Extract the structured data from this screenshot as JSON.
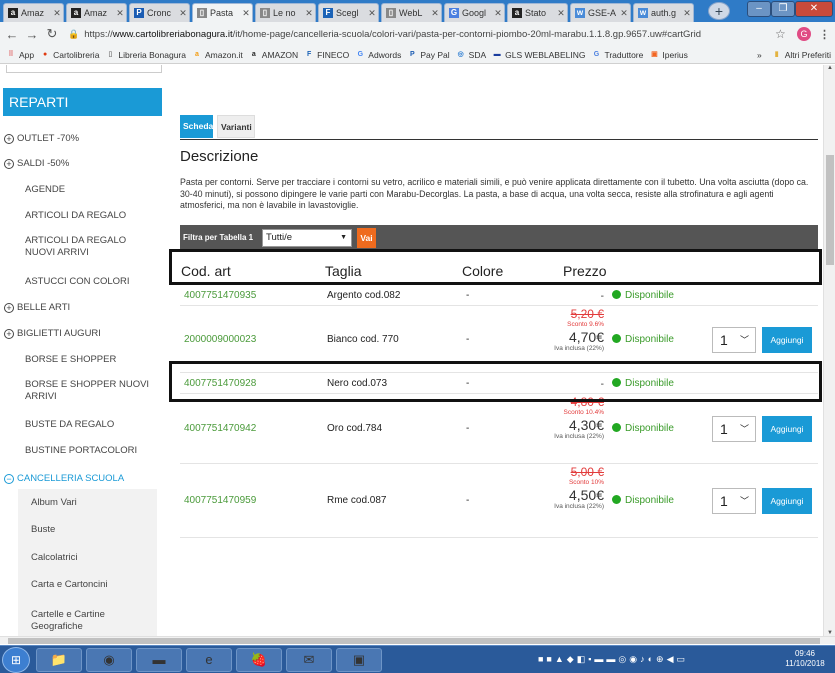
{
  "browser": {
    "tabs": [
      {
        "title": "Amaz",
        "icon": "amazon-icon",
        "color": "#222222",
        "glyph": "a"
      },
      {
        "title": "Amaz",
        "icon": "amazon-icon",
        "color": "#222222",
        "glyph": "a"
      },
      {
        "title": "Cronc",
        "icon": "paypal-icon",
        "color": "#1b5cb3",
        "glyph": "P"
      },
      {
        "title": "Pasta",
        "icon": "page-icon",
        "color": "#888888",
        "glyph": "▯"
      },
      {
        "title": "Le no",
        "icon": "page-icon",
        "color": "#888888",
        "glyph": "▯"
      },
      {
        "title": "Scegl",
        "icon": "fineco-icon",
        "color": "#1c63b7",
        "glyph": "F"
      },
      {
        "title": "WebL",
        "icon": "page-icon",
        "color": "#888888",
        "glyph": "▯"
      },
      {
        "title": "Googl",
        "icon": "google-translate-icon",
        "color": "#4a7fe0",
        "glyph": "G"
      },
      {
        "title": "Stato",
        "icon": "amazon-icon",
        "color": "#222222",
        "glyph": "a"
      },
      {
        "title": "GSE-A",
        "icon": "gse-icon",
        "color": "#4a8bd8",
        "glyph": "w"
      },
      {
        "title": "auth.g",
        "icon": "gse-icon",
        "color": "#4a8bd8",
        "glyph": "w"
      }
    ],
    "active_tab_index": 3,
    "new_tab_symbol": "+",
    "window_buttons": {
      "minimize": "–",
      "maximize": "❐",
      "close": "✕"
    },
    "url_prefix": "https://",
    "url_domain": "www.cartolibreriabonagura.it",
    "url_path": "/it/home-page/cancelleria-scuola/colori-vari/pasta-per-contorni-piombo-20ml-marabu.1.1.8.gp.9657.uw#cartGrid",
    "profile_initial": "G",
    "bookmarks": [
      {
        "label": "App",
        "icon": "apps-icon",
        "color": "#e06666",
        "glyph": "⠿"
      },
      {
        "label": "Cartolibreria",
        "icon": "cartolibreria-icon",
        "color": "#e03a10",
        "glyph": "●"
      },
      {
        "label": "Libreria Bonagura",
        "icon": "page-icon",
        "color": "#888888",
        "glyph": "▯"
      },
      {
        "label": "Amazon.it",
        "icon": "amazon-icon",
        "color": "#f39c12",
        "glyph": "a"
      },
      {
        "label": "AMAZON",
        "icon": "amazon-icon",
        "color": "#222222",
        "glyph": "a"
      },
      {
        "label": "FINECO",
        "icon": "fineco-icon",
        "color": "#1c63b7",
        "glyph": "F"
      },
      {
        "label": "Adwords",
        "icon": "google-icon",
        "color": "#4285f4",
        "glyph": "G"
      },
      {
        "label": "Pay Pal",
        "icon": "paypal-icon",
        "color": "#1b5cb3",
        "glyph": "P"
      },
      {
        "label": "SDA",
        "icon": "sda-icon",
        "color": "#2d7dd2",
        "glyph": "◎"
      },
      {
        "label": "GLS WEBLABELING",
        "icon": "gls-icon",
        "color": "#1a3c9e",
        "glyph": "▬"
      },
      {
        "label": "Traduttore",
        "icon": "translate-icon",
        "color": "#4a7fe0",
        "glyph": "G"
      },
      {
        "label": "Iperius",
        "icon": "iperius-icon",
        "color": "#f26522",
        "glyph": "▣"
      }
    ],
    "bookmarks_more": "»",
    "other_bookmarks": "Altri Preferiti"
  },
  "sidebar": {
    "heading": "REPARTI",
    "items": [
      {
        "label": "OUTLET -70%",
        "expandable": true
      },
      {
        "label": "SALDI -50%",
        "expandable": true
      },
      {
        "label": "AGENDE",
        "expandable": false
      },
      {
        "label": "ARTICOLI DA REGALO",
        "expandable": false
      },
      {
        "label": "ARTICOLI DA REGALO NUOVI ARRIVI",
        "expandable": false
      },
      {
        "label": "ASTUCCI CON COLORI",
        "expandable": false
      },
      {
        "label": "BELLE ARTI",
        "expandable": true
      },
      {
        "label": "BIGLIETTI AUGURI",
        "expandable": true
      },
      {
        "label": "BORSE E SHOPPER",
        "expandable": false
      },
      {
        "label": "BORSE E SHOPPER NUOVI ARRIVI",
        "expandable": false
      },
      {
        "label": "BUSTE DA REGALO",
        "expandable": false
      },
      {
        "label": "BUSTINE PORTACOLORI",
        "expandable": false
      },
      {
        "label": "CANCELLERIA SCUOLA",
        "expandable": true,
        "active": true
      }
    ],
    "sub_items": [
      {
        "label": "Album Vari"
      },
      {
        "label": "Buste"
      },
      {
        "label": "Calcolatrici"
      },
      {
        "label": "Carta e Cartoncini"
      },
      {
        "label": "Cartelle e Cartine Geografiche"
      }
    ]
  },
  "product": {
    "tabs": [
      {
        "label": "Scheda"
      },
      {
        "label": "Varianti"
      }
    ],
    "description_title": "Descrizione",
    "description_text": "Pasta per contorni. Serve per tracciare i contorni su vetro, acrilico e materiali simili, e può venire applicata direttamente con il tubetto. Una volta asciutta (dopo ca. 30-40 minuti), si possono dipingere le varie parti con Marabu-Decorglas. La pasta, a base di acqua, una volta secca, resiste alla strofinatura e agli agenti atmosferici, ma non è lavabile in lavastoviglie.",
    "filter": {
      "label": "Filtra per Tabella 1",
      "selected": "Tutti/e",
      "button": "Vai"
    },
    "columns": {
      "code": "Cod. art",
      "size": "Taglia",
      "color": "Colore",
      "price": "Prezzo"
    },
    "rows": [
      {
        "code": "4007751470935",
        "size": "Argento cod.082",
        "color": "-",
        "old_price": "",
        "discount": "",
        "price": "-",
        "vat": "",
        "availability": "Disponibile",
        "qty": "",
        "add": ""
      },
      {
        "code": "2000009000023",
        "size": "Bianco cod. 770",
        "color": "-",
        "old_price": "5,20 €",
        "discount": "Sconto 9.6%",
        "price": "4,70€",
        "vat": "Iva inclusa (22%)",
        "availability": "Disponibile",
        "qty": "1",
        "add": "Aggiungi"
      },
      {
        "code": "4007751470928",
        "size": "Nero cod.073",
        "color": "-",
        "old_price": "",
        "discount": "",
        "price": "-",
        "vat": "",
        "availability": "Disponibile",
        "qty": "",
        "add": ""
      },
      {
        "code": "4007751470942",
        "size": "Oro cod.784",
        "color": "-",
        "old_price": "4,80 €",
        "discount": "Sconto 10.4%",
        "price": "4,30€",
        "vat": "Iva inclusa (22%)",
        "availability": "Disponibile",
        "qty": "1",
        "add": "Aggiungi"
      },
      {
        "code": "4007751470959",
        "size": "Rme cod.087",
        "color": "-",
        "old_price": "5,00 €",
        "discount": "Sconto 10%",
        "price": "4,50€",
        "vat": "Iva inclusa (22%)",
        "availability": "Disponibile",
        "qty": "1",
        "add": "Aggiungi"
      }
    ]
  },
  "taskbar": {
    "apps": [
      {
        "name": "explorer-icon",
        "glyph": "📁"
      },
      {
        "name": "chrome-icon",
        "glyph": "◉"
      },
      {
        "name": "terminal-icon",
        "glyph": "▬"
      },
      {
        "name": "ie-icon",
        "glyph": "e"
      },
      {
        "name": "strawberry-icon",
        "glyph": "🍓"
      },
      {
        "name": "mail-icon",
        "glyph": "✉"
      },
      {
        "name": "media-icon",
        "glyph": "▣"
      }
    ],
    "time": "09:46",
    "date": "11/10/2018"
  },
  "colors": {
    "accent": "#1a9ad6",
    "available": "#22a822",
    "code_link": "#4a9a3a",
    "discount": "#e23b3b",
    "filter_button": "#ef6b1e"
  }
}
